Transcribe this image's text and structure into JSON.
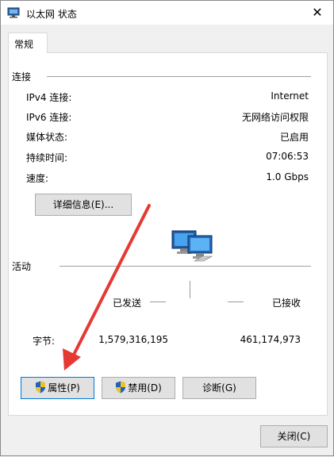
{
  "window": {
    "title": "以太网 状态"
  },
  "tabs": [
    {
      "label": "常规"
    }
  ],
  "connection": {
    "title": "连接",
    "rows": [
      {
        "label": "IPv4 连接:",
        "value": "Internet"
      },
      {
        "label": "IPv6 连接:",
        "value": "无网络访问权限"
      },
      {
        "label": "媒体状态:",
        "value": "已启用"
      },
      {
        "label": "持续时间:",
        "value": "07:06:53"
      },
      {
        "label": "速度:",
        "value": "1.0 Gbps"
      }
    ],
    "details_button": "详细信息(E)..."
  },
  "activity": {
    "title": "活动",
    "sent_label": "已发送",
    "received_label": "已接收",
    "bytes_label": "字节:",
    "bytes_sent": "1,579,316,195",
    "bytes_received": "461,174,973"
  },
  "buttons": {
    "properties": "属性(P)",
    "disable": "禁用(D)",
    "diagnose": "诊断(G)",
    "close": "关闭(C)"
  },
  "icons": {
    "app": "network-adapter-icon",
    "close": "close-icon",
    "shield": "uac-shield-icon",
    "activity": "network-computers-icon"
  },
  "colors": {
    "annotation_arrow": "#e53935",
    "focus_border": "#0078d7"
  }
}
